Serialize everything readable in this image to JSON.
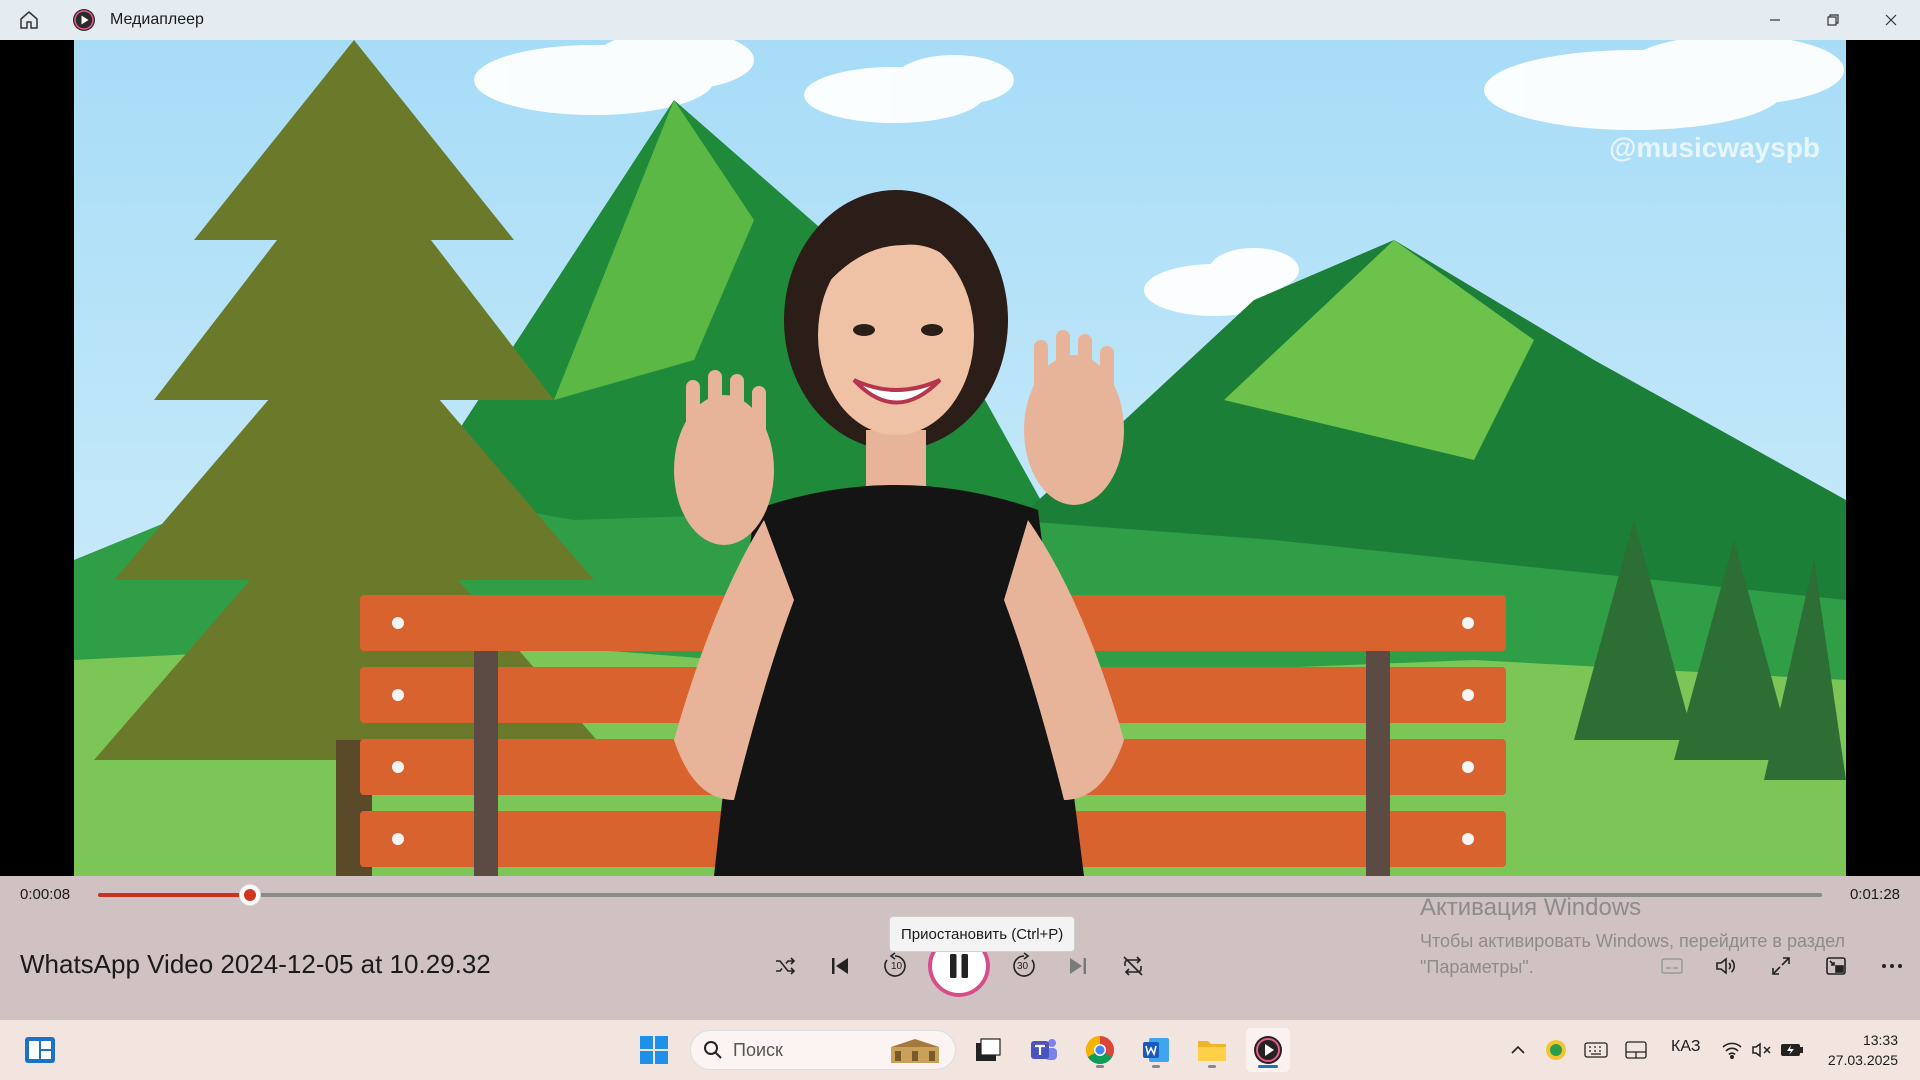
{
  "window": {
    "title": "Медиаплеер",
    "icons": [
      "home-icon",
      "media-player-icon",
      "minimize-icon",
      "restore-icon",
      "close-icon"
    ]
  },
  "video": {
    "watermark": "@musicwayspb"
  },
  "player": {
    "time_elapsed": "0:00:08",
    "time_total": "0:01:28",
    "progress_fraction": 0.088,
    "media_title": "WhatsApp Video 2024-12-05 at 10.29.32",
    "tooltip": "Приостановить (Ctrl+P)",
    "skip_back_label": "10",
    "skip_forward_label": "30",
    "accent_color": "#d1361f",
    "controls": [
      "shuffle-icon",
      "previous-icon",
      "skip-back-10-icon",
      "pause-icon",
      "skip-forward-30-icon",
      "next-icon",
      "repeat-icon",
      "subtitles-icon",
      "volume-icon",
      "fullscreen-icon",
      "mini-player-icon",
      "more-icon"
    ]
  },
  "activation": {
    "title": "Активация Windows",
    "line1": "Чтобы активировать Windows, перейдите в раздел",
    "line2": "\"Параметры\"."
  },
  "taskbar": {
    "search_placeholder": "Поиск",
    "language": "КАЗ",
    "time": "13:33",
    "date": "27.03.2025",
    "apps": [
      "widgets-icon",
      "start-icon",
      "search-icon",
      "task-view-icon",
      "teams-icon",
      "chrome-icon",
      "word-icon",
      "file-explorer-icon",
      "media-player-icon"
    ]
  }
}
